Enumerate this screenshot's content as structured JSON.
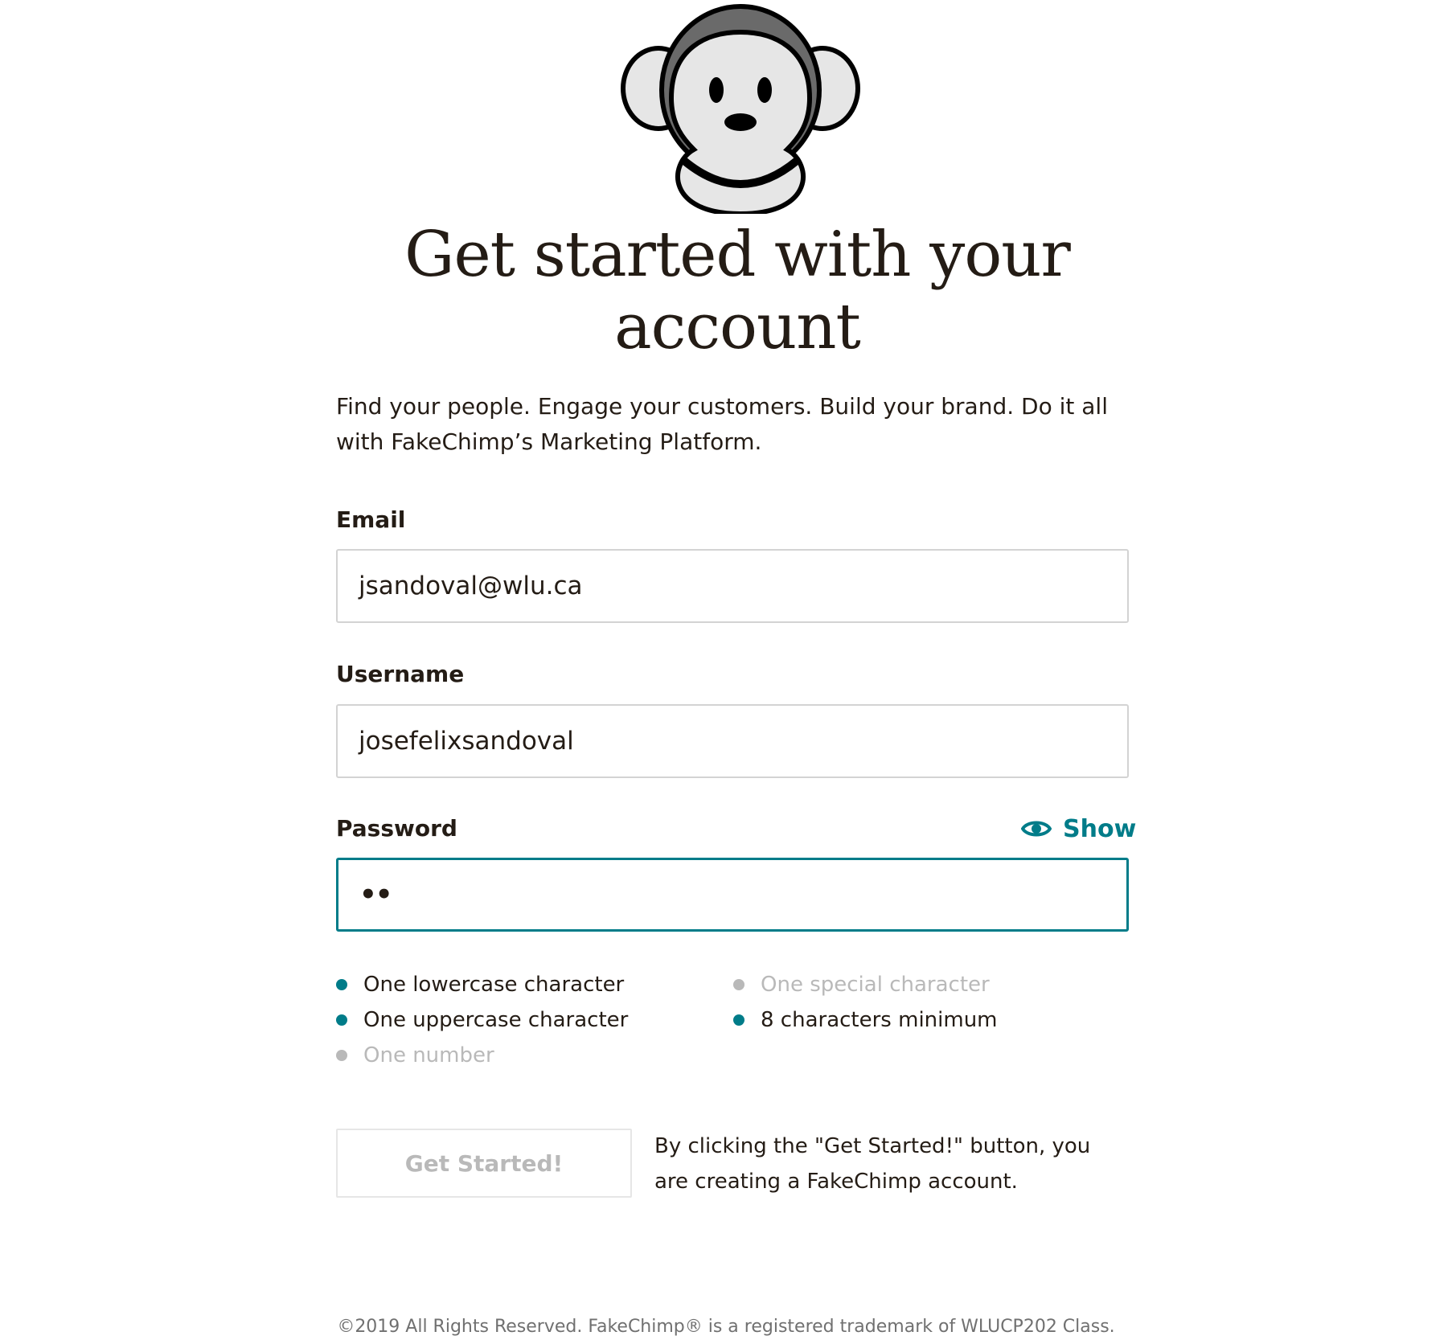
{
  "header": {
    "logo_icon": "monkey-mascot-icon",
    "title": "Get started with your account",
    "tagline": "Find your people. Engage your customers. Build your brand. Do it all with FakeChimp’s Marketing Platform."
  },
  "form": {
    "email": {
      "label": "Email",
      "value": "jsandoval@wlu.ca"
    },
    "username": {
      "label": "Username",
      "value": "josefelixsandoval"
    },
    "password": {
      "label": "Password",
      "value_masked": "••",
      "show_label": "Show",
      "show_icon": "eye-icon"
    },
    "rules": [
      {
        "text": "One lowercase character",
        "met": true
      },
      {
        "text": "One uppercase character",
        "met": true
      },
      {
        "text": "One number",
        "met": false
      },
      {
        "text": "One special character",
        "met": false
      },
      {
        "text": "8 characters minimum",
        "met": true
      }
    ],
    "submit_label": "Get Started!",
    "terms": "By clicking the \"Get Started!\" button, you are creating a FakeChimp account."
  },
  "footer": {
    "text": "©2019 All Rights Reserved. FakeChimp® is a registered trademark of WLUCP202 Class."
  },
  "colors": {
    "accent": "#007c89",
    "text": "#241c15",
    "muted": "#b9b9b9",
    "border": "#d3d3d3"
  }
}
